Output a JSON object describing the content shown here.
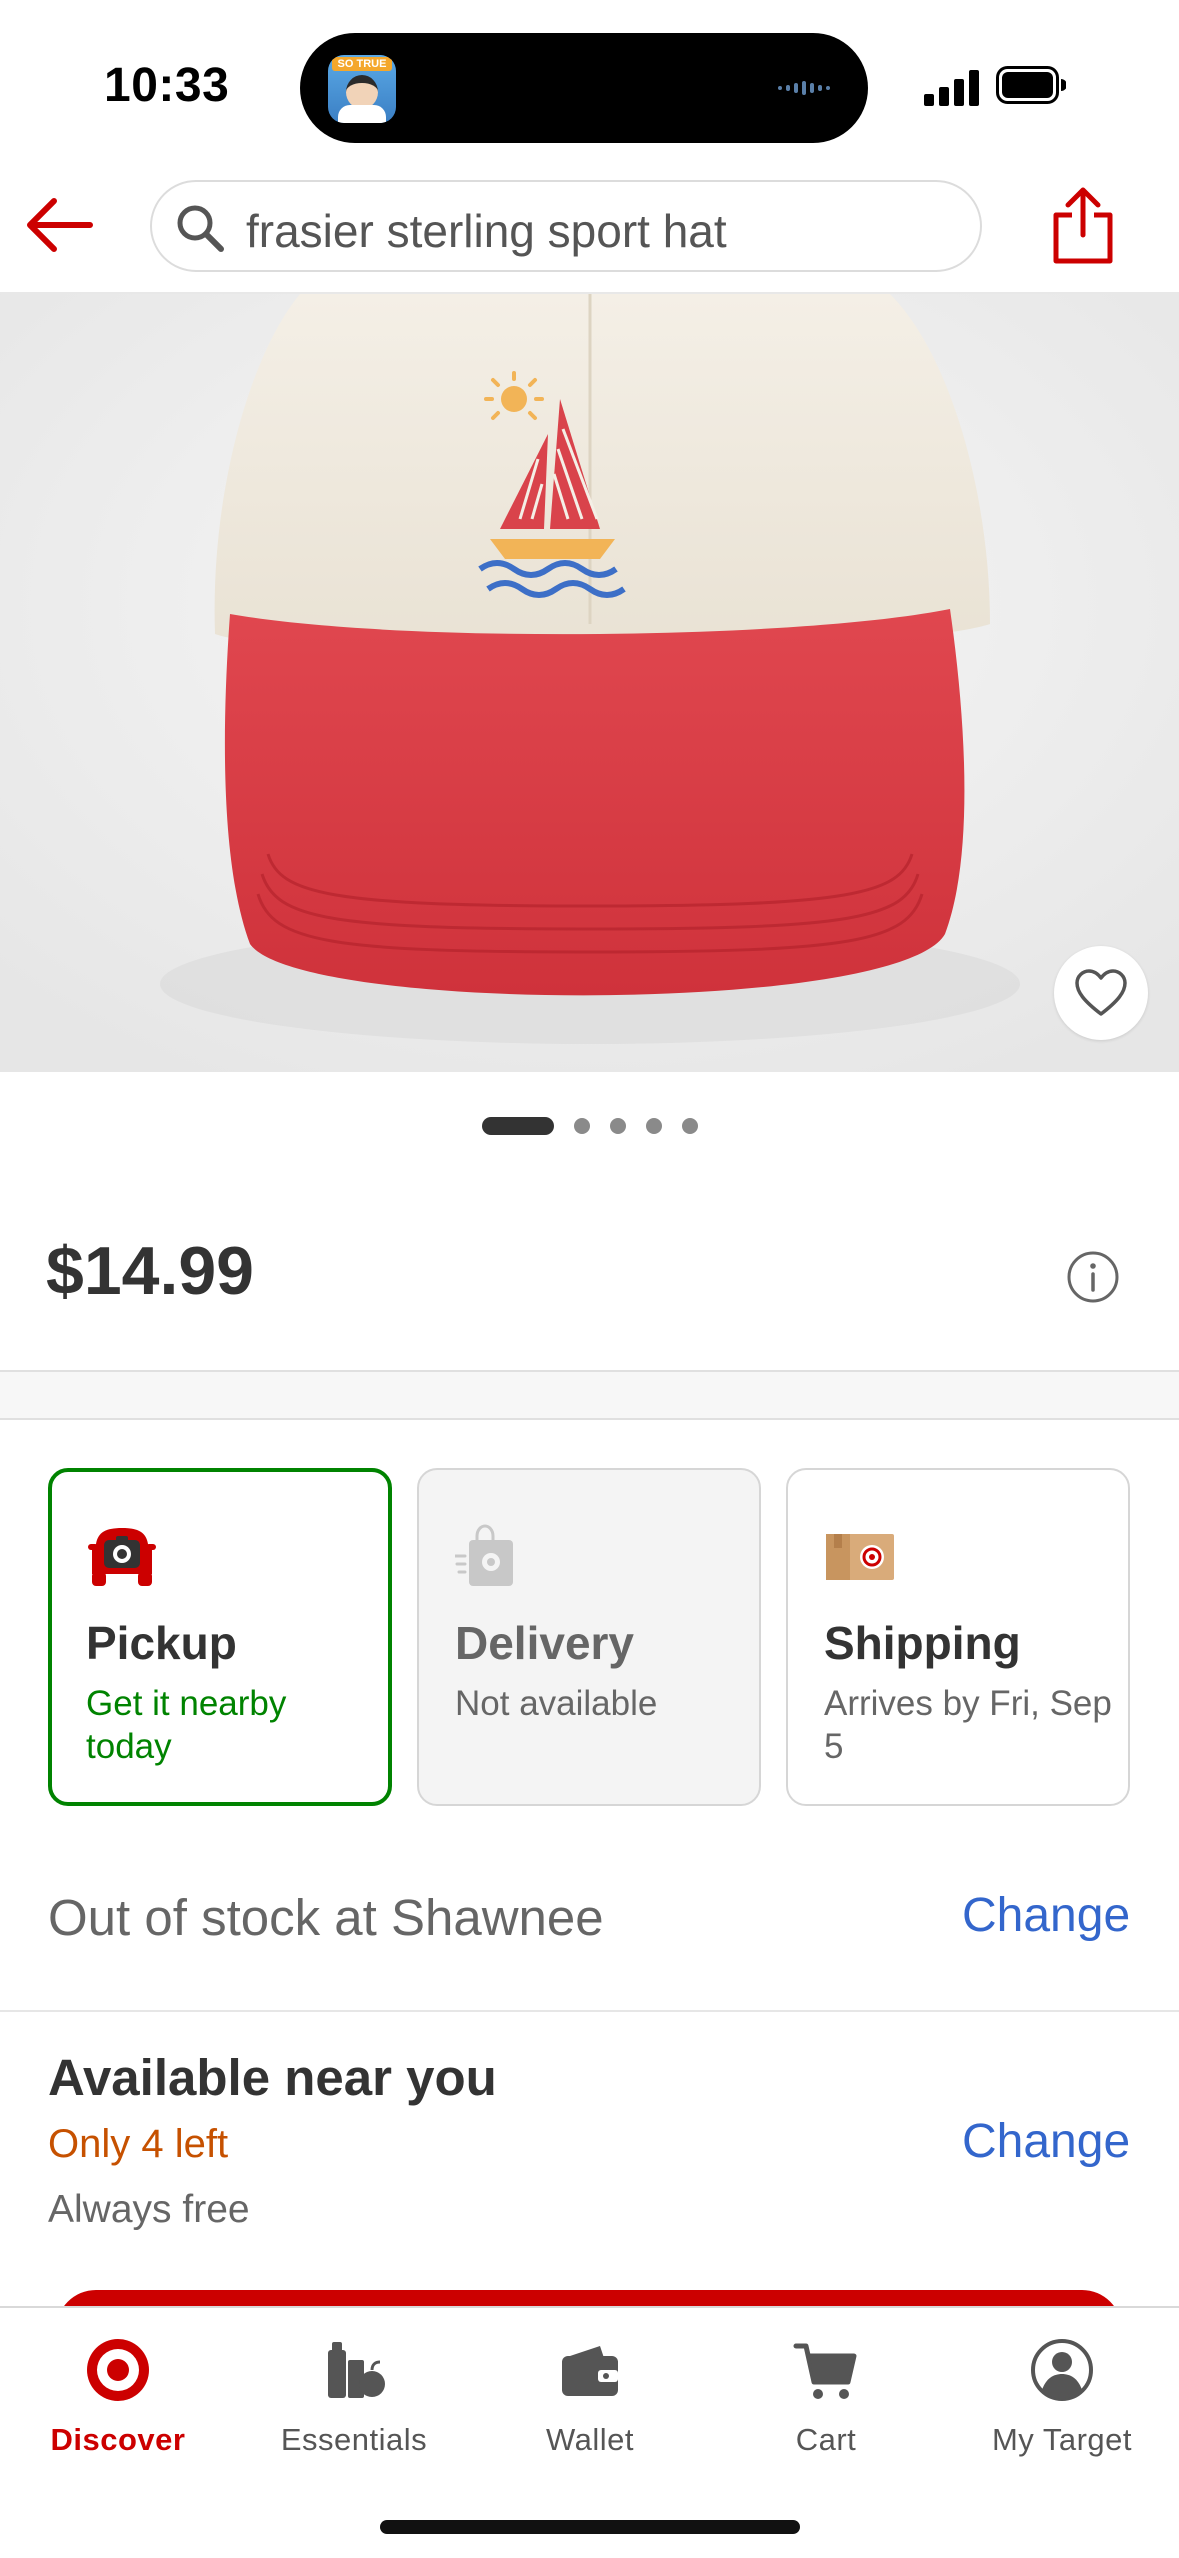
{
  "status_bar": {
    "time": "10:33",
    "island_badge": "SO TRUE"
  },
  "search": {
    "query": "frasier sterling sport hat"
  },
  "product": {
    "image_count": 5,
    "image_index": 1,
    "price": "$14.99"
  },
  "fulfillment": {
    "pickup": {
      "title": "Pickup",
      "subtitle": "Get it nearby today",
      "selected": true
    },
    "delivery": {
      "title": "Delivery",
      "subtitle": "Not available",
      "enabled": false
    },
    "shipping": {
      "title": "Shipping",
      "subtitle": "Arrives by Fri, Sep 5"
    }
  },
  "stock": {
    "message": "Out of stock at Shawnee",
    "change_label": "Change"
  },
  "nearby": {
    "title": "Available near you",
    "quantity": "Only 4 left",
    "change_label": "Change",
    "cost": "Always free"
  },
  "tab_bar": {
    "tabs": [
      {
        "label": "Discover",
        "icon": "target-logo-icon",
        "active": true
      },
      {
        "label": "Essentials",
        "icon": "essentials-icon"
      },
      {
        "label": "Wallet",
        "icon": "wallet-icon"
      },
      {
        "label": "Cart",
        "icon": "cart-icon"
      },
      {
        "label": "My Target",
        "icon": "account-icon"
      }
    ]
  },
  "colors": {
    "brand_red": "#cc0000",
    "selected_green": "#008300",
    "link_blue": "#3366cc",
    "low_stock_orange": "#c65100"
  }
}
